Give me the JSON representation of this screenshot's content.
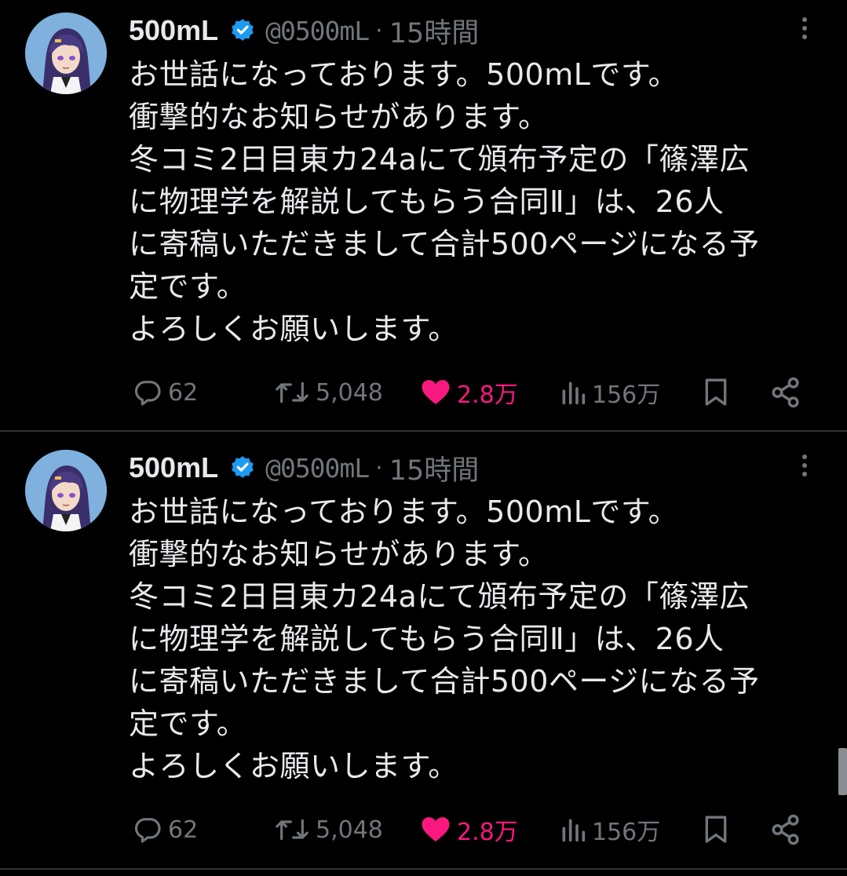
{
  "tweets": [
    {
      "display_name": "500mL",
      "handle": "@0500mL",
      "separator": "·",
      "time": "15時間",
      "lines": [
        "お世話になっております。500mLです。",
        "衝撃的なお知らせがあります。",
        "冬コミ2日目東カ24aにて頒布予定の「篠澤広",
        "に物理学を解説してもらう合同Ⅱ」は、26人",
        "に寄稿いただきまして合計500ページになる予",
        "定です。",
        "よろしくお願いします。"
      ],
      "replies": "62",
      "retweets": "5,048",
      "likes": "2.8万",
      "views": "156万",
      "liked": true
    },
    {
      "display_name": "500mL",
      "handle": "@0500mL",
      "separator": "·",
      "time": "15時間",
      "lines": [
        "お世話になっております。500mLです。",
        "衝撃的なお知らせがあります。",
        "冬コミ2日目東カ24aにて頒布予定の「篠澤広",
        "に物理学を解説してもらう合同Ⅱ」は、26人",
        "に寄稿いただきまして合計500ページになる予",
        "定です。",
        "よろしくお願いします。"
      ],
      "replies": "62",
      "retweets": "5,048",
      "likes": "2.8万",
      "views": "156万",
      "liked": true
    }
  ],
  "icons": {
    "verified": "verified-badge-icon",
    "more": "more-options-icon",
    "reply": "reply-icon",
    "retweet": "retweet-icon",
    "like": "heart-icon",
    "views": "views-icon",
    "bookmark": "bookmark-icon",
    "share": "share-icon"
  },
  "colors": {
    "background": "#000000",
    "text": "#e7e9ea",
    "secondary": "#71767b",
    "like": "#f91880",
    "verified": "#1d9bf0",
    "divider": "#2f3336"
  }
}
